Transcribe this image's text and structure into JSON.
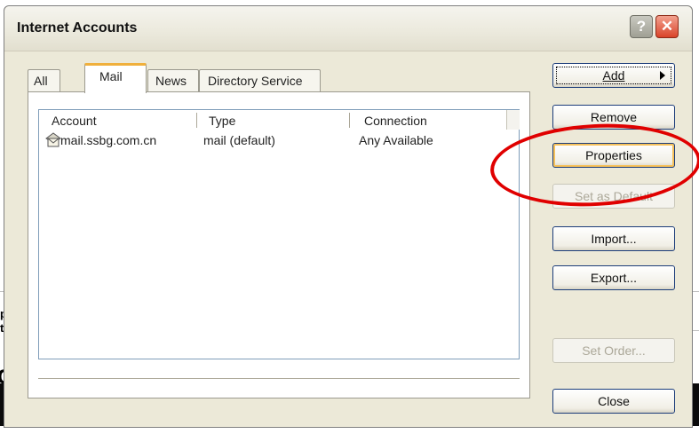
{
  "window": {
    "title": "Internet Accounts"
  },
  "titlebar": {
    "help_label": "?",
    "close_label": "✕"
  },
  "tabs": [
    {
      "label": "All"
    },
    {
      "label": "Mail"
    },
    {
      "label": "News"
    },
    {
      "label": "Directory Service"
    }
  ],
  "table": {
    "columns": [
      "Account",
      "Type",
      "Connection"
    ],
    "rows": [
      {
        "account": "mail.ssbg.com.cn",
        "type": "mail (default)",
        "connection": "Any Available",
        "icon": "mail-account-icon"
      }
    ]
  },
  "buttons": {
    "add": "Add",
    "remove": "Remove",
    "properties": "Properties",
    "set_default": "Set as Default",
    "import": "Import...",
    "export": "Export...",
    "set_order": "Set Order...",
    "close": "Close"
  },
  "background": {
    "char_p": "p",
    "char_t": "t",
    "char_o": "o"
  },
  "colors": {
    "annotation": "#e00000",
    "tab_highlight": "#f0b03c",
    "dialog_bg": "#ece9d8"
  }
}
